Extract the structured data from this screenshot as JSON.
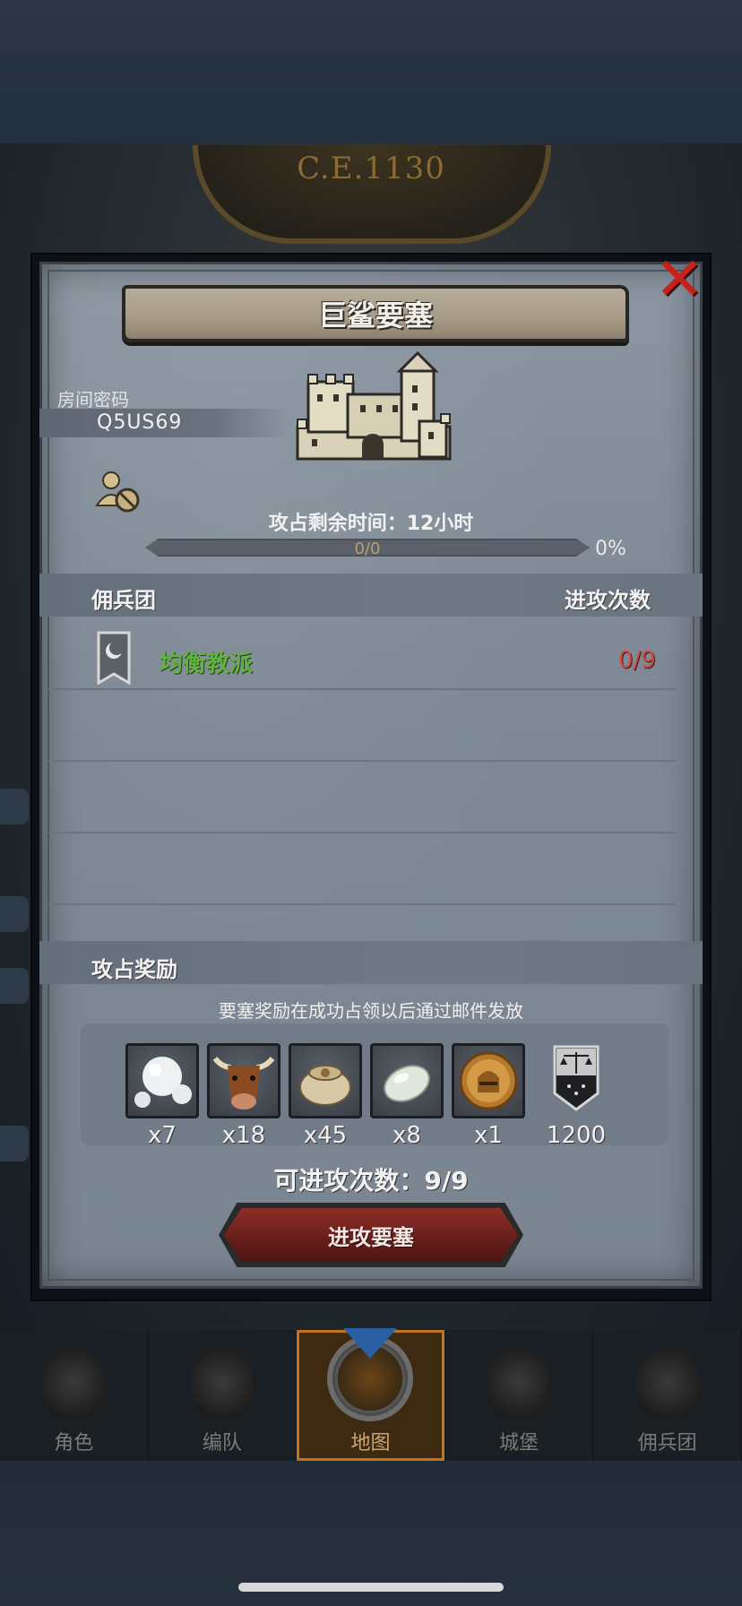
{
  "background": {
    "era": "C.E.1130"
  },
  "dialog": {
    "title": "巨鲨要塞",
    "close_icon": "close-x-icon",
    "room_code_label": "房间密码",
    "room_code_value": "Q5US69",
    "private_icon": "no-entry-user-icon",
    "timer_text": "攻占剩余时间：12小时",
    "progress": {
      "text": "0/0",
      "percent_text": "0%",
      "fraction": 0
    },
    "mercenary_header": "佣兵团",
    "attack_count_header": "进攻次数",
    "mercenaries": [
      {
        "name": "均衡教派",
        "attacks": "0/9",
        "icon": "guild-banner-icon"
      }
    ],
    "rewards_header": "攻占奖励",
    "rewards_note": "要塞奖励在成功占领以后通过邮件发放",
    "rewards": [
      {
        "icon": "pearls-icon",
        "qty": "x7"
      },
      {
        "icon": "ox-head-icon",
        "qty": "x18"
      },
      {
        "icon": "grain-sack-icon",
        "qty": "x45"
      },
      {
        "icon": "moonstone-icon",
        "qty": "x8"
      },
      {
        "icon": "knight-medal-icon",
        "qty": "x1"
      },
      {
        "icon": "justice-banner-icon",
        "qty": "1200"
      }
    ],
    "attacks_left": "可进攻次数：9/9",
    "attack_button": "进攻要塞"
  },
  "nav": {
    "items": [
      {
        "label": "角色",
        "icon": "armor-character-icon"
      },
      {
        "label": "编队",
        "icon": "helmet-squad-icon"
      },
      {
        "label": "地图",
        "icon": "compass-map-icon",
        "active": true
      },
      {
        "label": "城堡",
        "icon": "castle-icon"
      },
      {
        "label": "佣兵团",
        "icon": "cavalry-guild-icon"
      }
    ]
  },
  "colors": {
    "panel": "#7e8995",
    "accent_red": "#c8201b",
    "guild_green": "#5fb33e",
    "count_red": "#cd4a40",
    "nav_active": "#c2731b"
  }
}
